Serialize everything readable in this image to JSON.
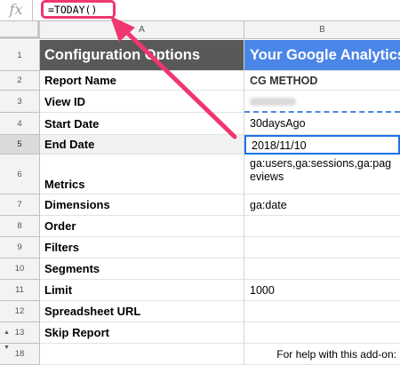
{
  "formula_bar": {
    "fx_label": "fx",
    "formula": "=TODAY()"
  },
  "columns": [
    {
      "id": "A",
      "label": "A"
    },
    {
      "id": "B",
      "label": "B"
    }
  ],
  "rows": [
    {
      "num": "1",
      "a": "Configuration Options",
      "b": "Your Google Analytics"
    },
    {
      "num": "2",
      "a": "Report Name",
      "b": "CG METHOD"
    },
    {
      "num": "3",
      "a": "View ID",
      "b": "blurred"
    },
    {
      "num": "4",
      "a": "Start Date",
      "b": "30daysAgo"
    },
    {
      "num": "5",
      "a": "End Date",
      "b": "2018/11/10"
    },
    {
      "num": "6",
      "a": "Metrics",
      "b": "ga:users,ga:sessions,ga:pag eviews"
    },
    {
      "num": "7",
      "a": "Dimensions",
      "b": "ga:date"
    },
    {
      "num": "8",
      "a": "Order",
      "b": ""
    },
    {
      "num": "9",
      "a": "Filters",
      "b": ""
    },
    {
      "num": "10",
      "a": "Segments",
      "b": ""
    },
    {
      "num": "11",
      "a": "Limit",
      "b": "1000"
    },
    {
      "num": "12",
      "a": "Spreadsheet URL",
      "b": ""
    },
    {
      "num": "13",
      "a": "Skip Report",
      "b": ""
    },
    {
      "num": "18",
      "a": "",
      "b": "For help with this add-on:"
    }
  ],
  "view_id_value": "",
  "theme": {
    "header_dark": "#595959",
    "header_blue": "#4a86e8",
    "highlight": "#f0366f",
    "selection": "#1a73e8"
  },
  "icons": {
    "formula": "fx-icon",
    "row_group_toggle": "up-down-arrow-icon"
  }
}
